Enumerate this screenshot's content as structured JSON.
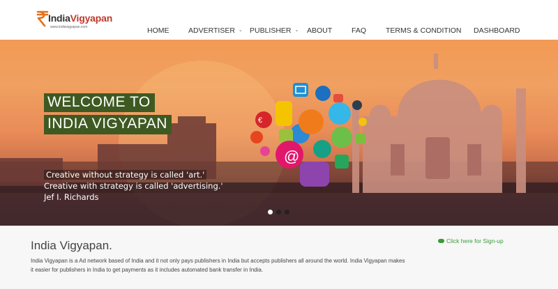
{
  "brand": {
    "name_part1": "India",
    "name_part2": "Vigyapan",
    "url": "www.indiavigyapan.com",
    "accent_color": "#c0392b"
  },
  "nav": {
    "items": [
      {
        "label": "HOME",
        "has_caret": false
      },
      {
        "label": "ADVERTISER",
        "has_caret": true
      },
      {
        "label": "PUBLISHER",
        "has_caret": true
      },
      {
        "label": "ABOUT",
        "has_caret": false
      },
      {
        "label": "FAQ",
        "has_caret": false
      },
      {
        "label": "TERMS & CONDITION",
        "has_caret": false
      },
      {
        "label": "DASHBOARD",
        "has_caret": false
      }
    ],
    "caret_icon": "chevron-down-icon"
  },
  "hero": {
    "headline_line1": "WELCOME TO",
    "headline_line2": "INDIA VIGYAPAN",
    "headline_bg": "#3e5a22",
    "quote_line1": " Creative without strategy is called 'art.'",
    "quote_line2": "Creative with strategy is called 'advertising.'",
    "quote_author": "Jef I. Richards",
    "slides": {
      "count": 3,
      "active": 1
    }
  },
  "about": {
    "title": "India Vigyapan.",
    "text": "India Vigyapan is a Ad network based of India and it not only pays publishers in India but accepts publishers all around the world. India Vigyapan makes it easier for publishers in India to get payments as it includes automated bank transfer in India.",
    "signup_label": "Click here for Sign-up",
    "signup_icon": "cloud-upload-icon",
    "signup_color": "#3a9a3a"
  }
}
